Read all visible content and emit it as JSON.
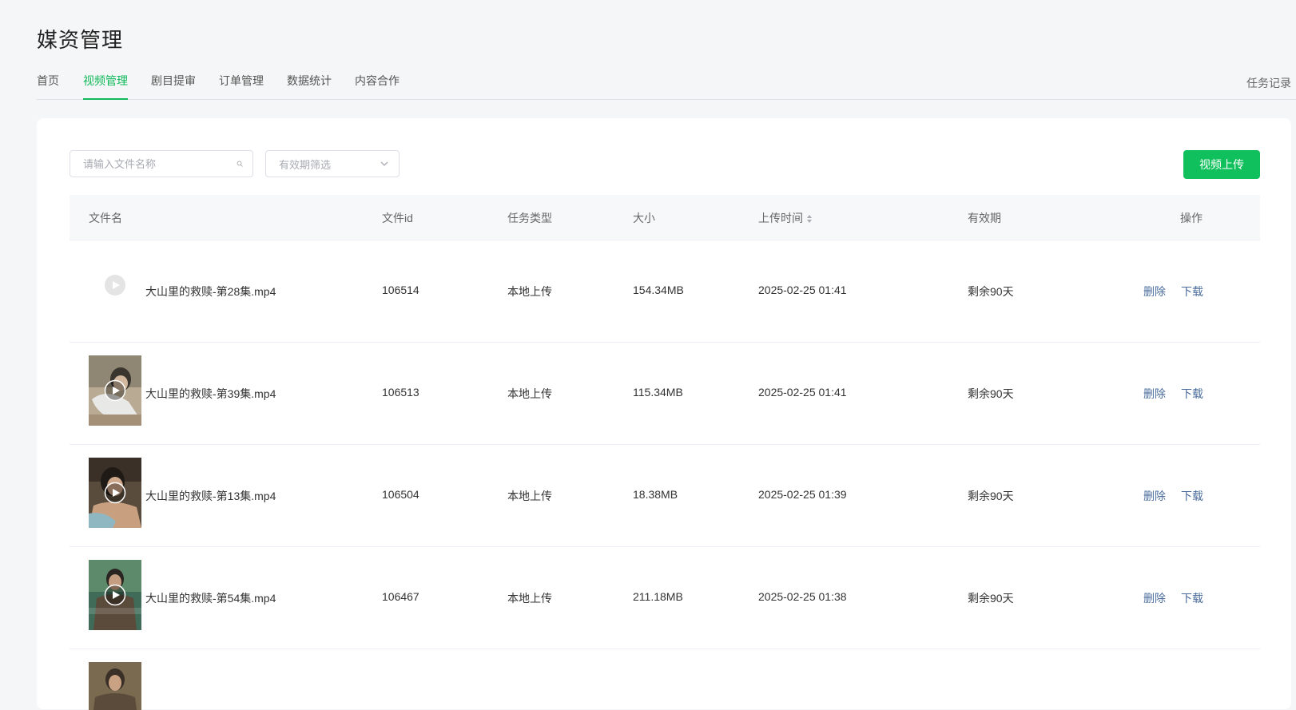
{
  "page": {
    "title": "媒资管理"
  },
  "nav": {
    "tabs": [
      {
        "label": "首页"
      },
      {
        "label": "视频管理",
        "active": true
      },
      {
        "label": "剧目提审"
      },
      {
        "label": "订单管理"
      },
      {
        "label": "数据统计"
      },
      {
        "label": "内容合作"
      }
    ],
    "task_record": "任务记录"
  },
  "toolbar": {
    "search_placeholder": "请输入文件名称",
    "filter_placeholder": "有效期筛选",
    "upload_label": "视频上传"
  },
  "table": {
    "headers": {
      "filename": "文件名",
      "file_id": "文件id",
      "task_type": "任务类型",
      "size": "大小",
      "upload_time": "上传时间",
      "validity": "有效期",
      "actions": "操作"
    },
    "rows": [
      {
        "filename": "大山里的救赎-第28集.mp4",
        "file_id": "106514",
        "task_type": "本地上传",
        "size": "154.34MB",
        "upload_time": "2025-02-25 01:41",
        "validity": "剩余90天",
        "delete": "删除",
        "download": "下载"
      },
      {
        "filename": "大山里的救赎-第39集.mp4",
        "file_id": "106513",
        "task_type": "本地上传",
        "size": "115.34MB",
        "upload_time": "2025-02-25 01:41",
        "validity": "剩余90天",
        "delete": "删除",
        "download": "下载"
      },
      {
        "filename": "大山里的救赎-第13集.mp4",
        "file_id": "106504",
        "task_type": "本地上传",
        "size": "18.38MB",
        "upload_time": "2025-02-25 01:39",
        "validity": "剩余90天",
        "delete": "删除",
        "download": "下载"
      },
      {
        "filename": "大山里的救赎-第54集.mp4",
        "file_id": "106467",
        "task_type": "本地上传",
        "size": "211.18MB",
        "upload_time": "2025-02-25 01:38",
        "validity": "剩余90天",
        "delete": "删除",
        "download": "下载"
      }
    ]
  },
  "colors": {
    "accent": "#10b95a",
    "link": "#4a6b9c"
  }
}
